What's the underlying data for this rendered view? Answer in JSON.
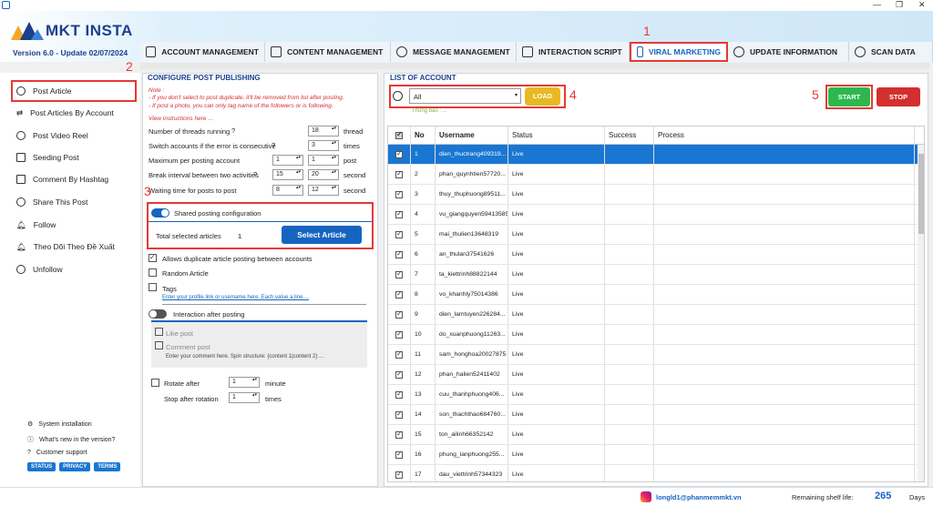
{
  "header": {
    "logo_text": "MKT INSTA",
    "version": "Version  6.0  - Update  02/07/2024"
  },
  "tabs": [
    {
      "label": "ACCOUNT MANAGEMENT"
    },
    {
      "label": "CONTENT MANAGEMENT"
    },
    {
      "label": "MESSAGE MANAGEMENT"
    },
    {
      "label": "INTERACTION SCRIPT"
    },
    {
      "label": "VIRAL MARKETING"
    },
    {
      "label": "UPDATE INFORMATION"
    },
    {
      "label": "SCAN DATA"
    }
  ],
  "sidebar": {
    "items": [
      {
        "label": "Post Article"
      },
      {
        "label": "Post Articles By Account"
      },
      {
        "label": "Post Video Reel"
      },
      {
        "label": "Seeding Post"
      },
      {
        "label": "Comment By Hashtag"
      },
      {
        "label": "Share This Post"
      },
      {
        "label": "Follow"
      },
      {
        "label": "Theo Dõi Theo Đề Xuất"
      },
      {
        "label": "Unfollow"
      }
    ],
    "footer": {
      "system": "System installation",
      "whatsnew": "What's new in the version?",
      "support": "Customer support",
      "status": "STATUS",
      "privacy": "PRIVACY",
      "terms": "TERMS"
    }
  },
  "config": {
    "title": "CONFIGURE POST PUBLISHING",
    "note_title": "Note :",
    "note1": "- If you don't select to post duplicate, it'll be removed from list after posting.",
    "note2": "- If post a photo, you can only tag name of the followers or is following.",
    "view_instructions": "View instructions here ...",
    "threads_label": "Number of threads running",
    "threads_value": "18",
    "threads_unit": "thread",
    "switch_label": "Switch accounts if the error is consecutive",
    "switch_value": "3",
    "switch_unit": "times",
    "max_label": "Maximum per posting account",
    "max_from": "1",
    "max_to": "1",
    "max_unit": "post",
    "break_label": "Break interval between two activities",
    "break_from": "15",
    "break_to": "20",
    "break_unit": "second",
    "wait_label": "Waiting time for posts to post",
    "wait_from": "8",
    "wait_to": "12",
    "wait_unit": "second",
    "shared_label": "Shared posting configuration",
    "total_label": "Total selected articles",
    "total_value": "1",
    "select_article": "Select Article",
    "dup_label": "Allows duplicate article posting between accounts",
    "random_label": "Random Article",
    "tags_label": "Tags",
    "tags_hint": "Enter your profile link or username here. Each value a line ...",
    "interaction_label": "Interaction after posting",
    "like_label": "Like post",
    "comment_label": "Comment post",
    "comment_hint": "Enter your comment here. Spin structure: {content 1|content 2} ...",
    "rotate_label": "Rotate after",
    "rotate_value": "1",
    "rotate_unit": "minute",
    "stop_label": "Stop after rotation",
    "stop_value": "1",
    "stop_unit": "times"
  },
  "accounts": {
    "title": "LIST OF ACCOUNT",
    "filter": "All",
    "load": "LOAD",
    "thong_bao": "Thông báo : ...",
    "start": "START",
    "stop": "STOP",
    "columns": [
      "No",
      "Username",
      "Status",
      "Success",
      "Process"
    ],
    "rows": [
      {
        "no": "1",
        "user": "dien_thuctrang409319...",
        "status": "Live"
      },
      {
        "no": "2",
        "user": "phan_quynhtien57720...",
        "status": "Live"
      },
      {
        "no": "3",
        "user": "thuy_thuphuong89511...",
        "status": "Live"
      },
      {
        "no": "4",
        "user": "vu_giangquyen59413585",
        "status": "Live"
      },
      {
        "no": "5",
        "user": "mai_thulien13648319",
        "status": "Live"
      },
      {
        "no": "6",
        "user": "an_thulan37541626",
        "status": "Live"
      },
      {
        "no": "7",
        "user": "ta_kiettrinh88822144",
        "status": "Live"
      },
      {
        "no": "8",
        "user": "vo_khanhly75014386",
        "status": "Live"
      },
      {
        "no": "9",
        "user": "dien_lamtuyen226284...",
        "status": "Live"
      },
      {
        "no": "10",
        "user": "do_xuanphuong11263...",
        "status": "Live"
      },
      {
        "no": "11",
        "user": "sam_honghoa20027875",
        "status": "Live"
      },
      {
        "no": "12",
        "user": "phan_halien52411402",
        "status": "Live"
      },
      {
        "no": "13",
        "user": "cuu_thanhphuong406...",
        "status": "Live"
      },
      {
        "no": "14",
        "user": "son_thachthao684760...",
        "status": "Live"
      },
      {
        "no": "15",
        "user": "ton_ailinh66352142",
        "status": "Live"
      },
      {
        "no": "16",
        "user": "phung_lanphuong255...",
        "status": "Live"
      },
      {
        "no": "17",
        "user": "dau_viettrinh57344323",
        "status": "Live"
      }
    ]
  },
  "status_bar": {
    "email": "longld1@phanmemmkt.vn",
    "shelf_label": "Remaining shelf life:",
    "shelf_value": "265",
    "days": "Days"
  },
  "annotations": {
    "n1": "1",
    "n2": "2",
    "n3": "3",
    "n4": "4",
    "n5": "5"
  },
  "colors": {
    "accent": "#1565c0",
    "start": "#2db84d",
    "stop": "#d32f2f",
    "load": "#e8b923",
    "annotation": "#e53935"
  }
}
